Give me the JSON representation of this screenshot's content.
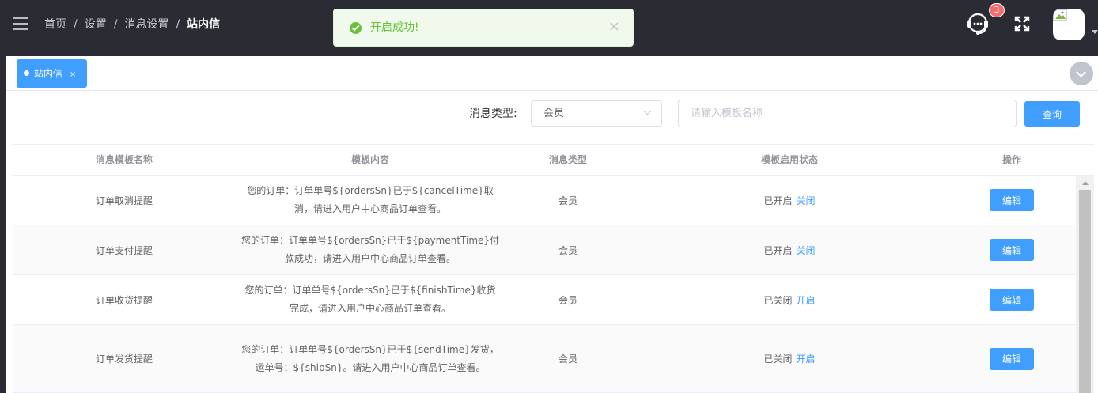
{
  "breadcrumb": [
    "首页",
    "设置",
    "消息设置",
    "站内信"
  ],
  "toast": {
    "message": "开启成功!",
    "close": "×"
  },
  "header": {
    "badge_count": "3"
  },
  "tags": {
    "active_label": "站内信",
    "close": "×"
  },
  "filter": {
    "type_label": "消息类型:",
    "type_value": "会员",
    "search_placeholder": "请输入模板名称",
    "query_label": "查询"
  },
  "table": {
    "columns": [
      "消息模板名称",
      "模板内容",
      "消息类型",
      "模板启用状态",
      "操作"
    ],
    "rows": [
      {
        "name": "订单取消提醒",
        "content": "您的订单：订单单号${ordersSn}已于${cancelTime}取消，请进入用户中心商品订单查看。",
        "type": "会员",
        "status": "已开启",
        "toggle": "关闭",
        "action": "编辑"
      },
      {
        "name": "订单支付提醒",
        "content": "您的订单：订单单号${ordersSn}已于${paymentTime}付款成功，请进入用户中心商品订单查看。",
        "type": "会员",
        "status": "已开启",
        "toggle": "关闭",
        "action": "编辑"
      },
      {
        "name": "订单收货提醒",
        "content": "您的订单：订单单号${ordersSn}已于${finishTime}收货完成，请进入用户中心商品订单查看。",
        "type": "会员",
        "status": "已关闭",
        "toggle": "开启",
        "action": "编辑"
      },
      {
        "name": "订单发货提醒",
        "content": "您的订单：订单单号${ordersSn}已于${sendTime}发货，运单号：${shipSn}。请进入用户中心商品订单查看。",
        "type": "会员",
        "status": "已关闭",
        "toggle": "开启",
        "action": "编辑"
      }
    ]
  },
  "icons": {
    "menu": "hamburger-icon",
    "success": "check-circle-icon",
    "support": "headset-icon",
    "fullscreen": "fullscreen-icon",
    "avatar": "broken-image-icon",
    "collapse": "chevron-down-icon"
  },
  "colors": {
    "primary": "#409eff",
    "success": "#67c23a",
    "danger": "#f56c6c",
    "header_bg": "#2b2c33"
  }
}
